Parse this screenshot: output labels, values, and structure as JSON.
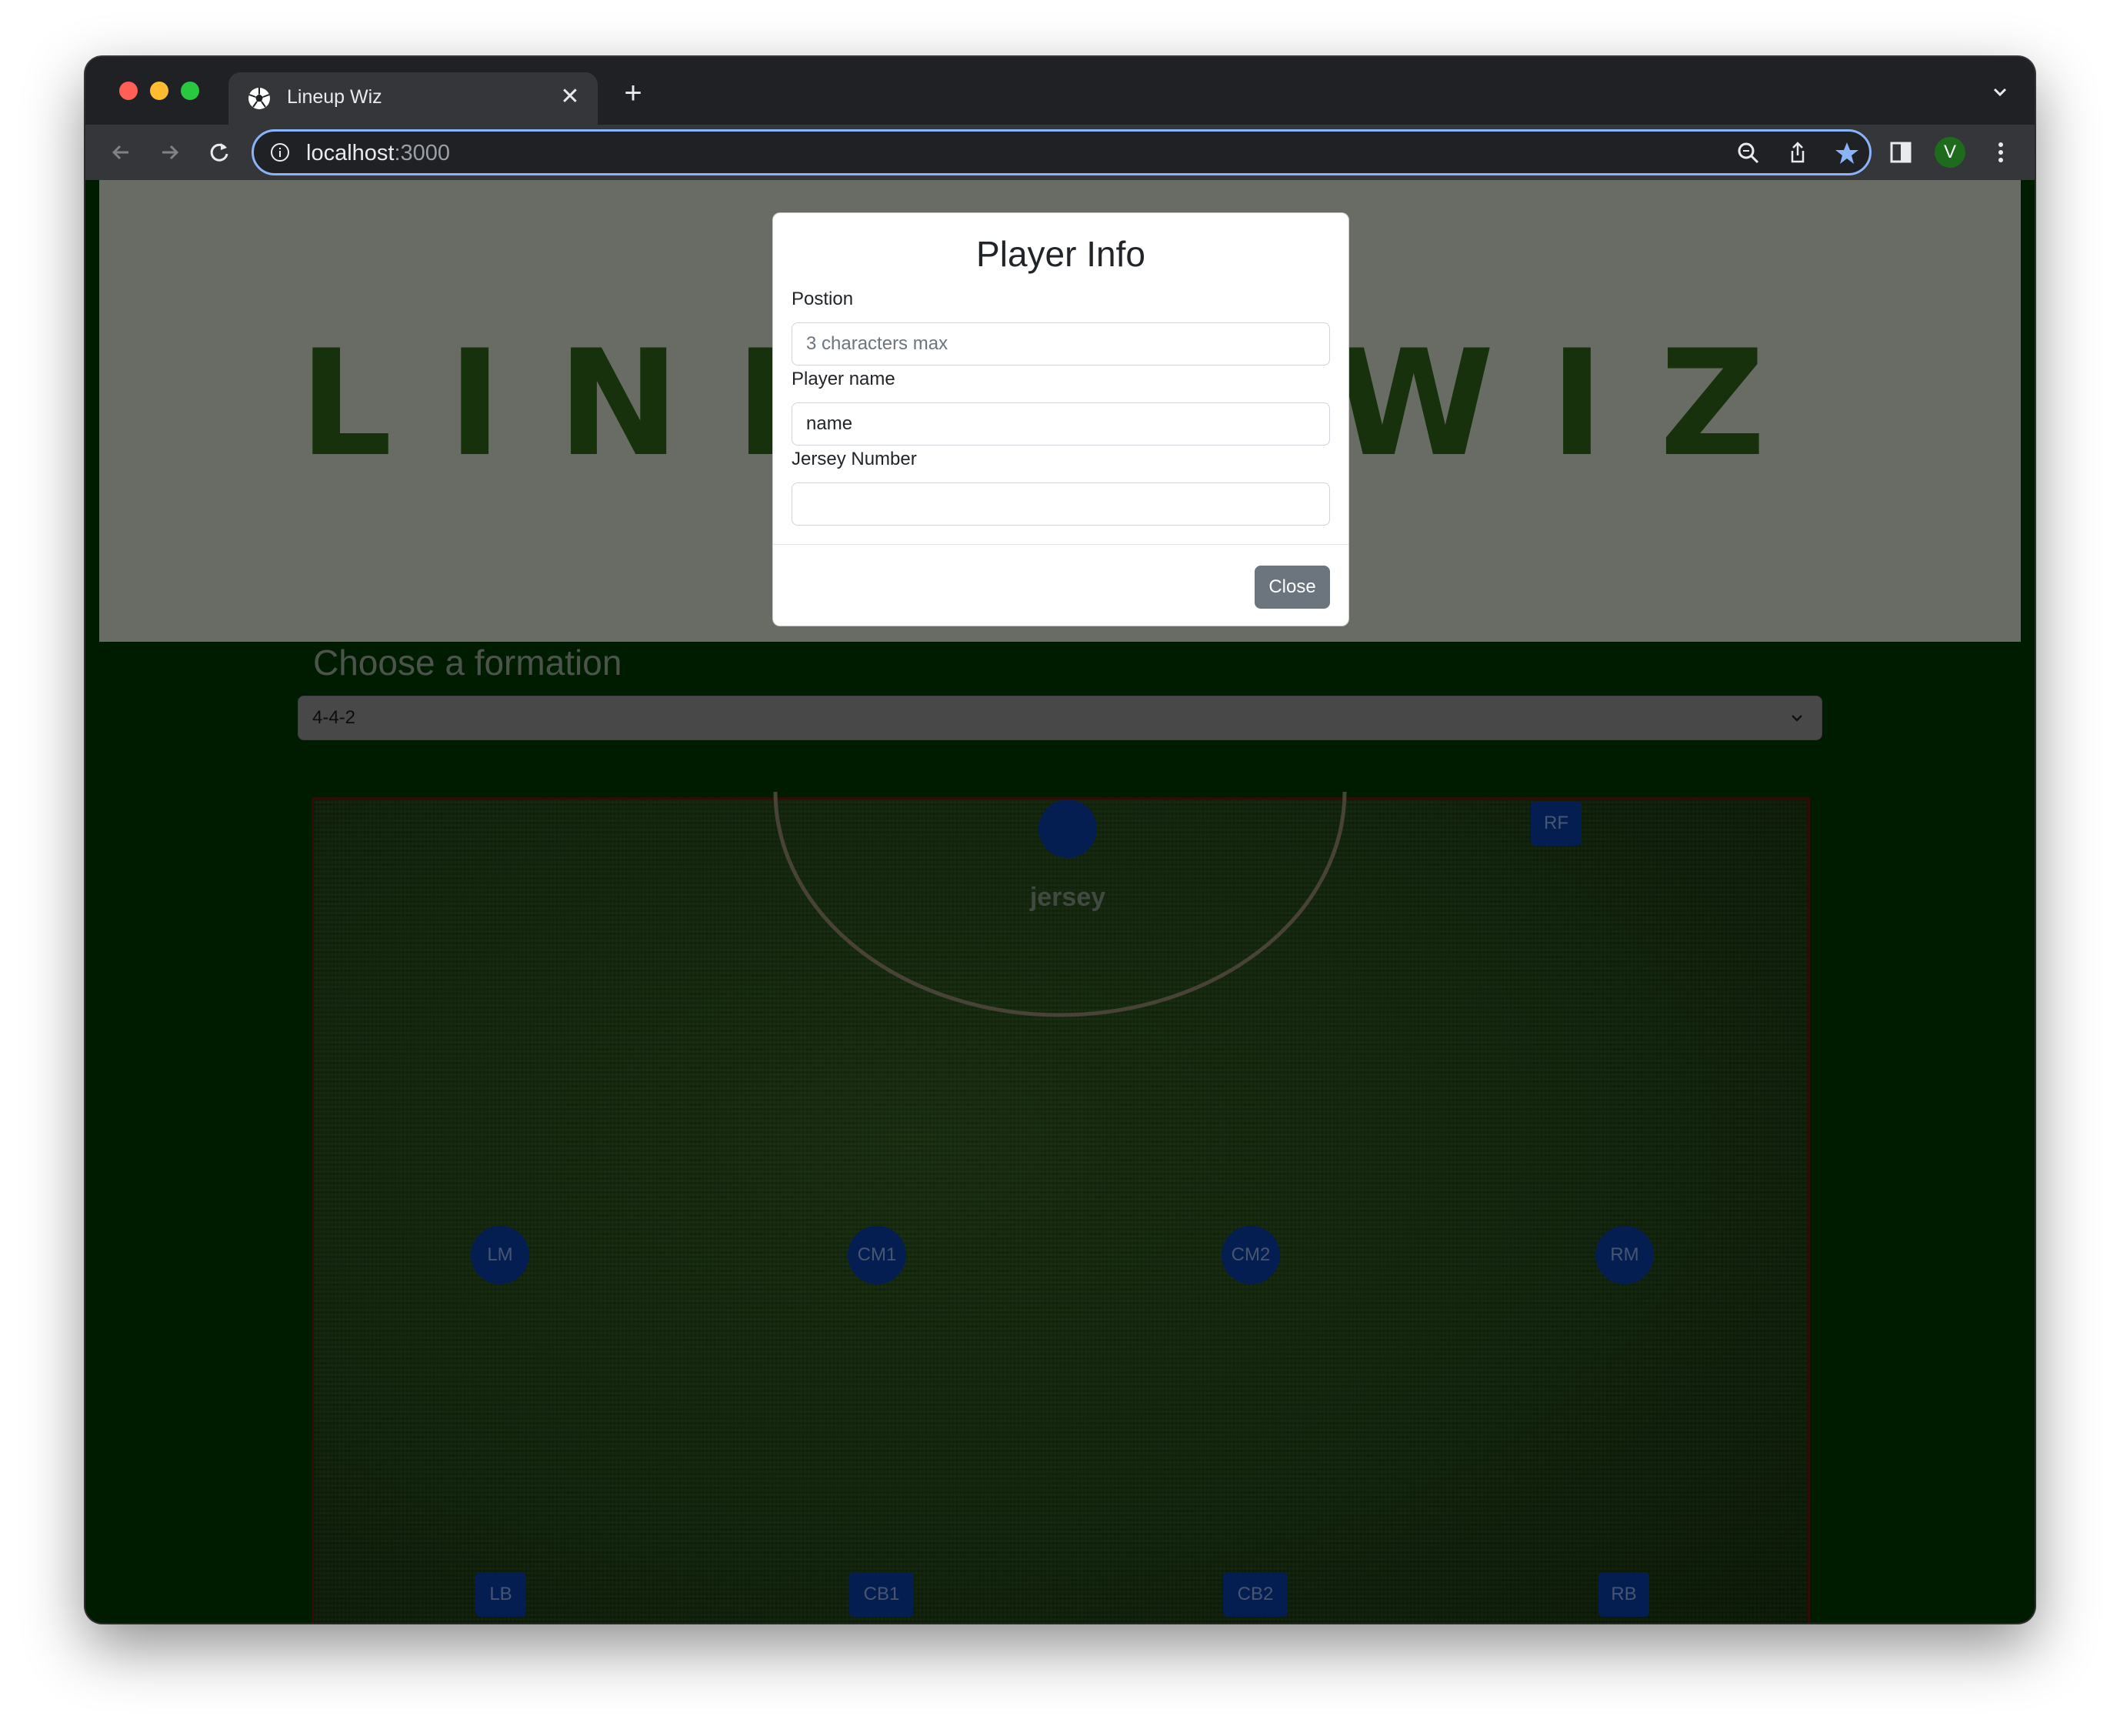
{
  "browser": {
    "tab_title": "Lineup Wiz",
    "tab_favicon": "soccer-ball-icon",
    "url_host": "localhost",
    "url_port": ":3000",
    "profile_initial": "V",
    "colors": {
      "frame": "#202124",
      "toolbar": "#35363a",
      "omnibox_focus": "#8ab4f8",
      "star": "#8ab4f8"
    }
  },
  "page": {
    "logo": "LINEUP WIZ",
    "formation_heading": "Choose a formation",
    "formation_select": {
      "value": "4-4-2"
    },
    "jersey_label": "jersey",
    "players": {
      "gk": "",
      "rf": "RF",
      "lm": "LM",
      "cm1": "CM1",
      "cm2": "CM2",
      "rm": "RM",
      "lb": "LB",
      "cb1": "CB1",
      "cb2": "CB2",
      "rb": "RB"
    },
    "colors": {
      "background": "#003600",
      "player": "#0a3a9e",
      "pitch_border": "#5a1a0a"
    }
  },
  "modal": {
    "title": "Player Info",
    "position_label": "Postion",
    "position_placeholder": "3 characters max",
    "name_label": "Player name",
    "name_value": "name",
    "jersey_label": "Jersey Number",
    "jersey_value": "",
    "close_label": "Close",
    "colors": {
      "close_button": "#6c757d"
    }
  }
}
